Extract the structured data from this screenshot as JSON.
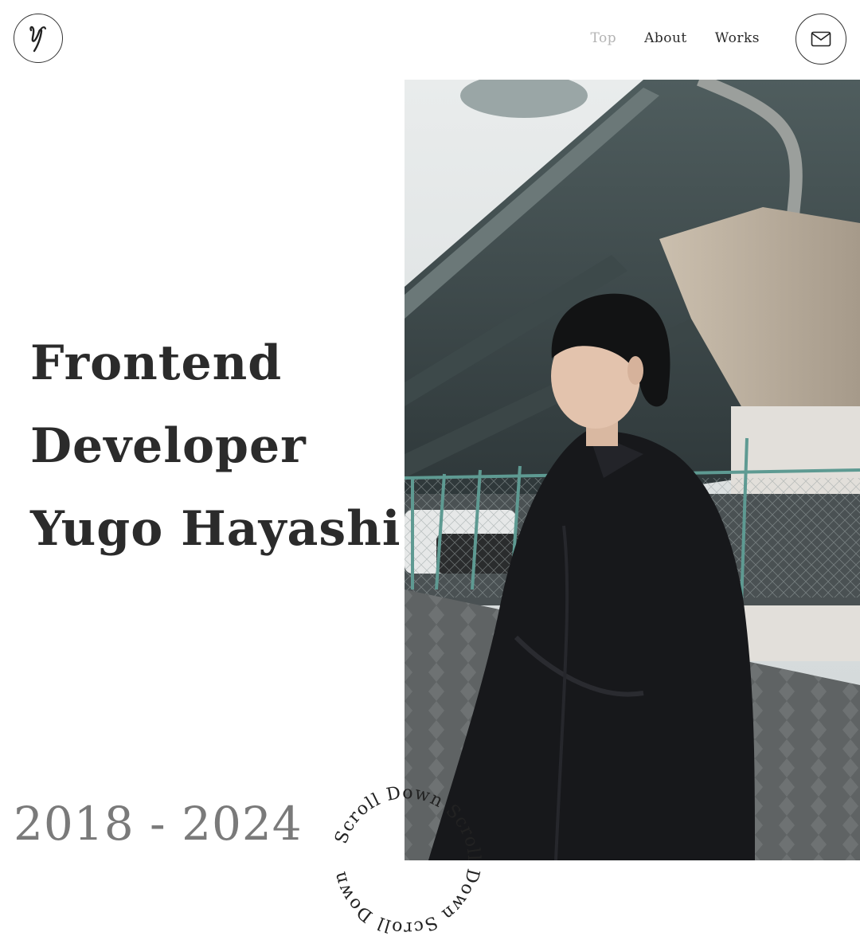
{
  "header": {
    "logo_icon": "signature-y-logo-icon",
    "nav": [
      {
        "label": "Top",
        "active": true
      },
      {
        "label": "About",
        "active": false
      },
      {
        "label": "Works",
        "active": false
      }
    ],
    "mail_icon": "mail-icon"
  },
  "hero": {
    "line1": "Frontend",
    "line2": "Developer",
    "line3": "Yugo Hayashi",
    "years": "2018 - 2024",
    "scroll_text": "Scroll Down Scroll Down Scroll Down "
  },
  "colors": {
    "text": "#2b2b2b",
    "nav_active": "#b4b4b4",
    "years": "#7a7a7a"
  }
}
